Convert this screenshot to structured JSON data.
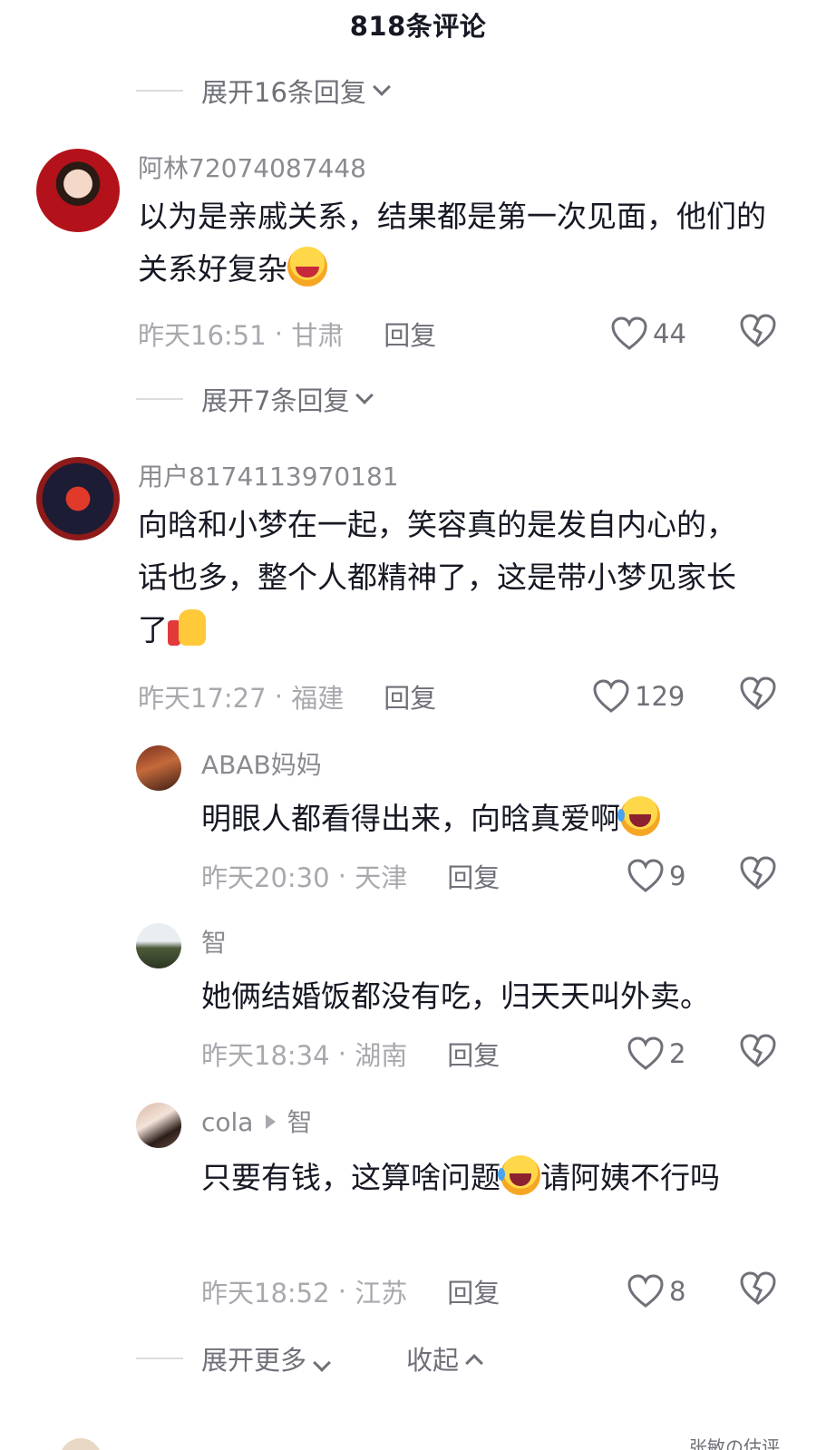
{
  "header": {
    "title": "818条评论"
  },
  "expand_top": {
    "label": "展开16条回复"
  },
  "comments": [
    {
      "username": "阿林72074087448",
      "text_parts": [
        "以为是亲戚关系，结果都是第一次见面，他们的关系好复杂"
      ],
      "emoji_after": "grinning-squint-emoji",
      "time": "昨天16:51",
      "location": "甘肃",
      "reply_label": "回复",
      "likes": "44",
      "expand_label": "展开7条回复"
    },
    {
      "username": "用户8174113970181",
      "text_parts": [
        "向晗和小梦在一起，笑容真的是发自内心的，话也多，整个人都精神了，这是带小梦见家长了"
      ],
      "emoji_after": "thumbs-up-emoji",
      "time": "昨天17:27",
      "location": "福建",
      "reply_label": "回复",
      "likes": "129"
    }
  ],
  "replies": [
    {
      "username": "ABAB妈妈",
      "text_parts": [
        "明眼人都看得出来，向晗真爱啊"
      ],
      "emoji_after": "laughing-crying-emoji",
      "time": "昨天20:30",
      "location": "天津",
      "reply_label": "回复",
      "likes": "9"
    },
    {
      "username": "智",
      "text_parts": [
        "她俩结婚饭都没有吃，归天天叫外卖。"
      ],
      "time": "昨天18:34",
      "location": "湖南",
      "reply_label": "回复",
      "likes": "2"
    },
    {
      "username": "cola",
      "reply_to": "智",
      "text_parts": [
        "只要有钱，这算啥问题",
        "请阿姨不行吗"
      ],
      "emoji_middle": "laughing-crying-emoji",
      "time": "昨天18:52",
      "location": "江苏",
      "reply_label": "回复",
      "likes": "8"
    }
  ],
  "bottom_actions": {
    "expand_more": "展开更多",
    "collapse": "收起"
  },
  "footer_peek": "张敏の估评",
  "icons": {
    "like": "heart-outline-icon",
    "dislike": "broken-heart-icon",
    "expand": "chevron-down-icon",
    "collapse": "chevron-up-icon",
    "reply_to": "triangle-right-icon"
  },
  "colors": {
    "text": "#161823",
    "secondary": "#8a8b91",
    "meta": "#a8a9ae",
    "action": "#6f7078"
  }
}
